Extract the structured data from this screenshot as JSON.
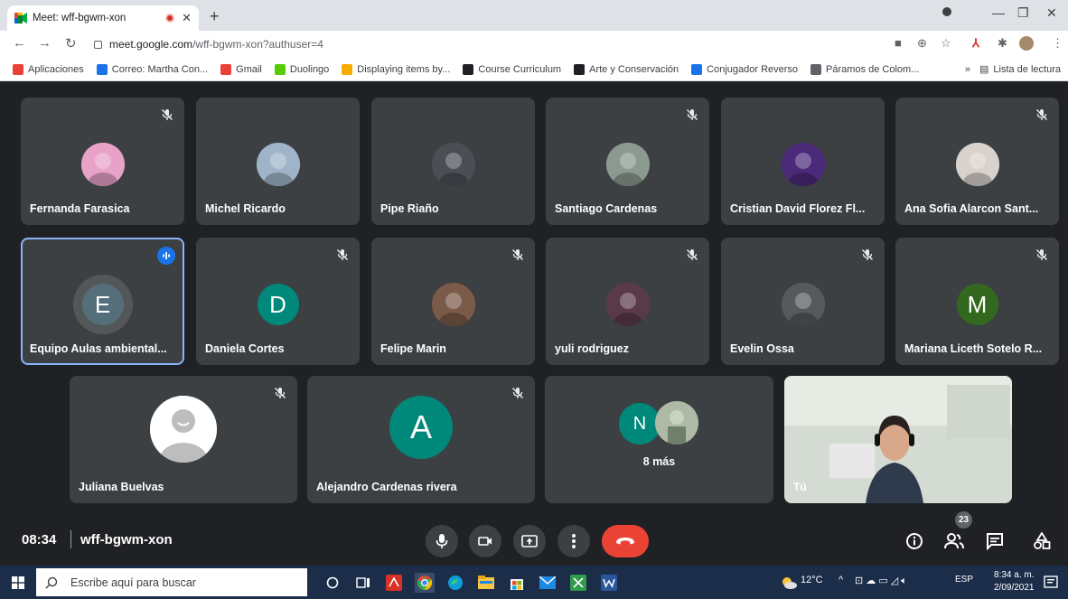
{
  "browser": {
    "tab_title": "Meet: wff-bgwm-xon",
    "url_host": "meet.google.com",
    "url_path": "/wff-bgwm-xon?authuser=4",
    "bookmarks": [
      {
        "label": "Aplicaciones",
        "color": "#ea4335"
      },
      {
        "label": "Correo: Martha Con...",
        "color": "#1a73e8"
      },
      {
        "label": "Gmail",
        "color": "#ea4335"
      },
      {
        "label": "Duolingo",
        "color": "#58cc02"
      },
      {
        "label": "Displaying items by...",
        "color": "#f9ab00"
      },
      {
        "label": "Course Curriculum",
        "color": "#202124"
      },
      {
        "label": "Arte y Conservación",
        "color": "#202124"
      },
      {
        "label": "Conjugador Reverso",
        "color": "#1a73e8"
      },
      {
        "label": "Páramos de Colom...",
        "color": "#5f6368"
      }
    ],
    "reading_list": "Lista de lectura"
  },
  "participants": [
    {
      "name": "Fernanda Farasica",
      "muted": true,
      "avatar": "photo",
      "color": "#e8a2c8"
    },
    {
      "name": "Michel Ricardo",
      "muted": false,
      "avatar": "photo",
      "color": "#9fb4c8"
    },
    {
      "name": "Pipe Riaño",
      "muted": false,
      "avatar": "photo",
      "color": "#4a4f55"
    },
    {
      "name": "Santiago Cardenas",
      "muted": true,
      "avatar": "photo",
      "color": "#8a9a8e"
    },
    {
      "name": "Cristian David Florez Fl...",
      "muted": false,
      "avatar": "photo",
      "color": "#4b2a7a"
    },
    {
      "name": "Ana Sofia Alarcon Sant...",
      "muted": true,
      "avatar": "photo",
      "color": "#d9d2cc"
    },
    {
      "name": "Equipo Aulas ambiental...",
      "muted": false,
      "avatar": "letter",
      "letter": "E",
      "color": "#546e7a",
      "speaking": true
    },
    {
      "name": "Daniela Cortes",
      "muted": true,
      "avatar": "letter",
      "letter": "D",
      "color": "#00897b"
    },
    {
      "name": "Felipe Marin",
      "muted": true,
      "avatar": "photo",
      "color": "#7a5a48"
    },
    {
      "name": "yuli rodriguez",
      "muted": true,
      "avatar": "photo",
      "color": "#5a3a4a"
    },
    {
      "name": "Evelin Ossa",
      "muted": true,
      "avatar": "photo",
      "color": "#555a5e"
    },
    {
      "name": "Mariana Liceth Sotelo R...",
      "muted": true,
      "avatar": "letter",
      "letter": "M",
      "color": "#33691e"
    },
    {
      "name": "Juliana Buelvas",
      "muted": true,
      "avatar": "default",
      "color": "#e0e0e0"
    },
    {
      "name": "Alejandro Cardenas rivera",
      "muted": true,
      "avatar": "letter",
      "letter": "A",
      "color": "#00897b"
    }
  ],
  "overflow": {
    "label": "8 más",
    "letter": "N",
    "letter_color": "#00897b"
  },
  "self": {
    "label": "Tú"
  },
  "meeting": {
    "time": "08:34",
    "code": "wff-bgwm-xon",
    "participant_count": "23"
  },
  "taskbar": {
    "search_placeholder": "Escribe aquí para buscar",
    "temperature": "12°C",
    "language": "ESP",
    "clock_time": "8:34 a. m.",
    "clock_date": "2/09/2021"
  }
}
